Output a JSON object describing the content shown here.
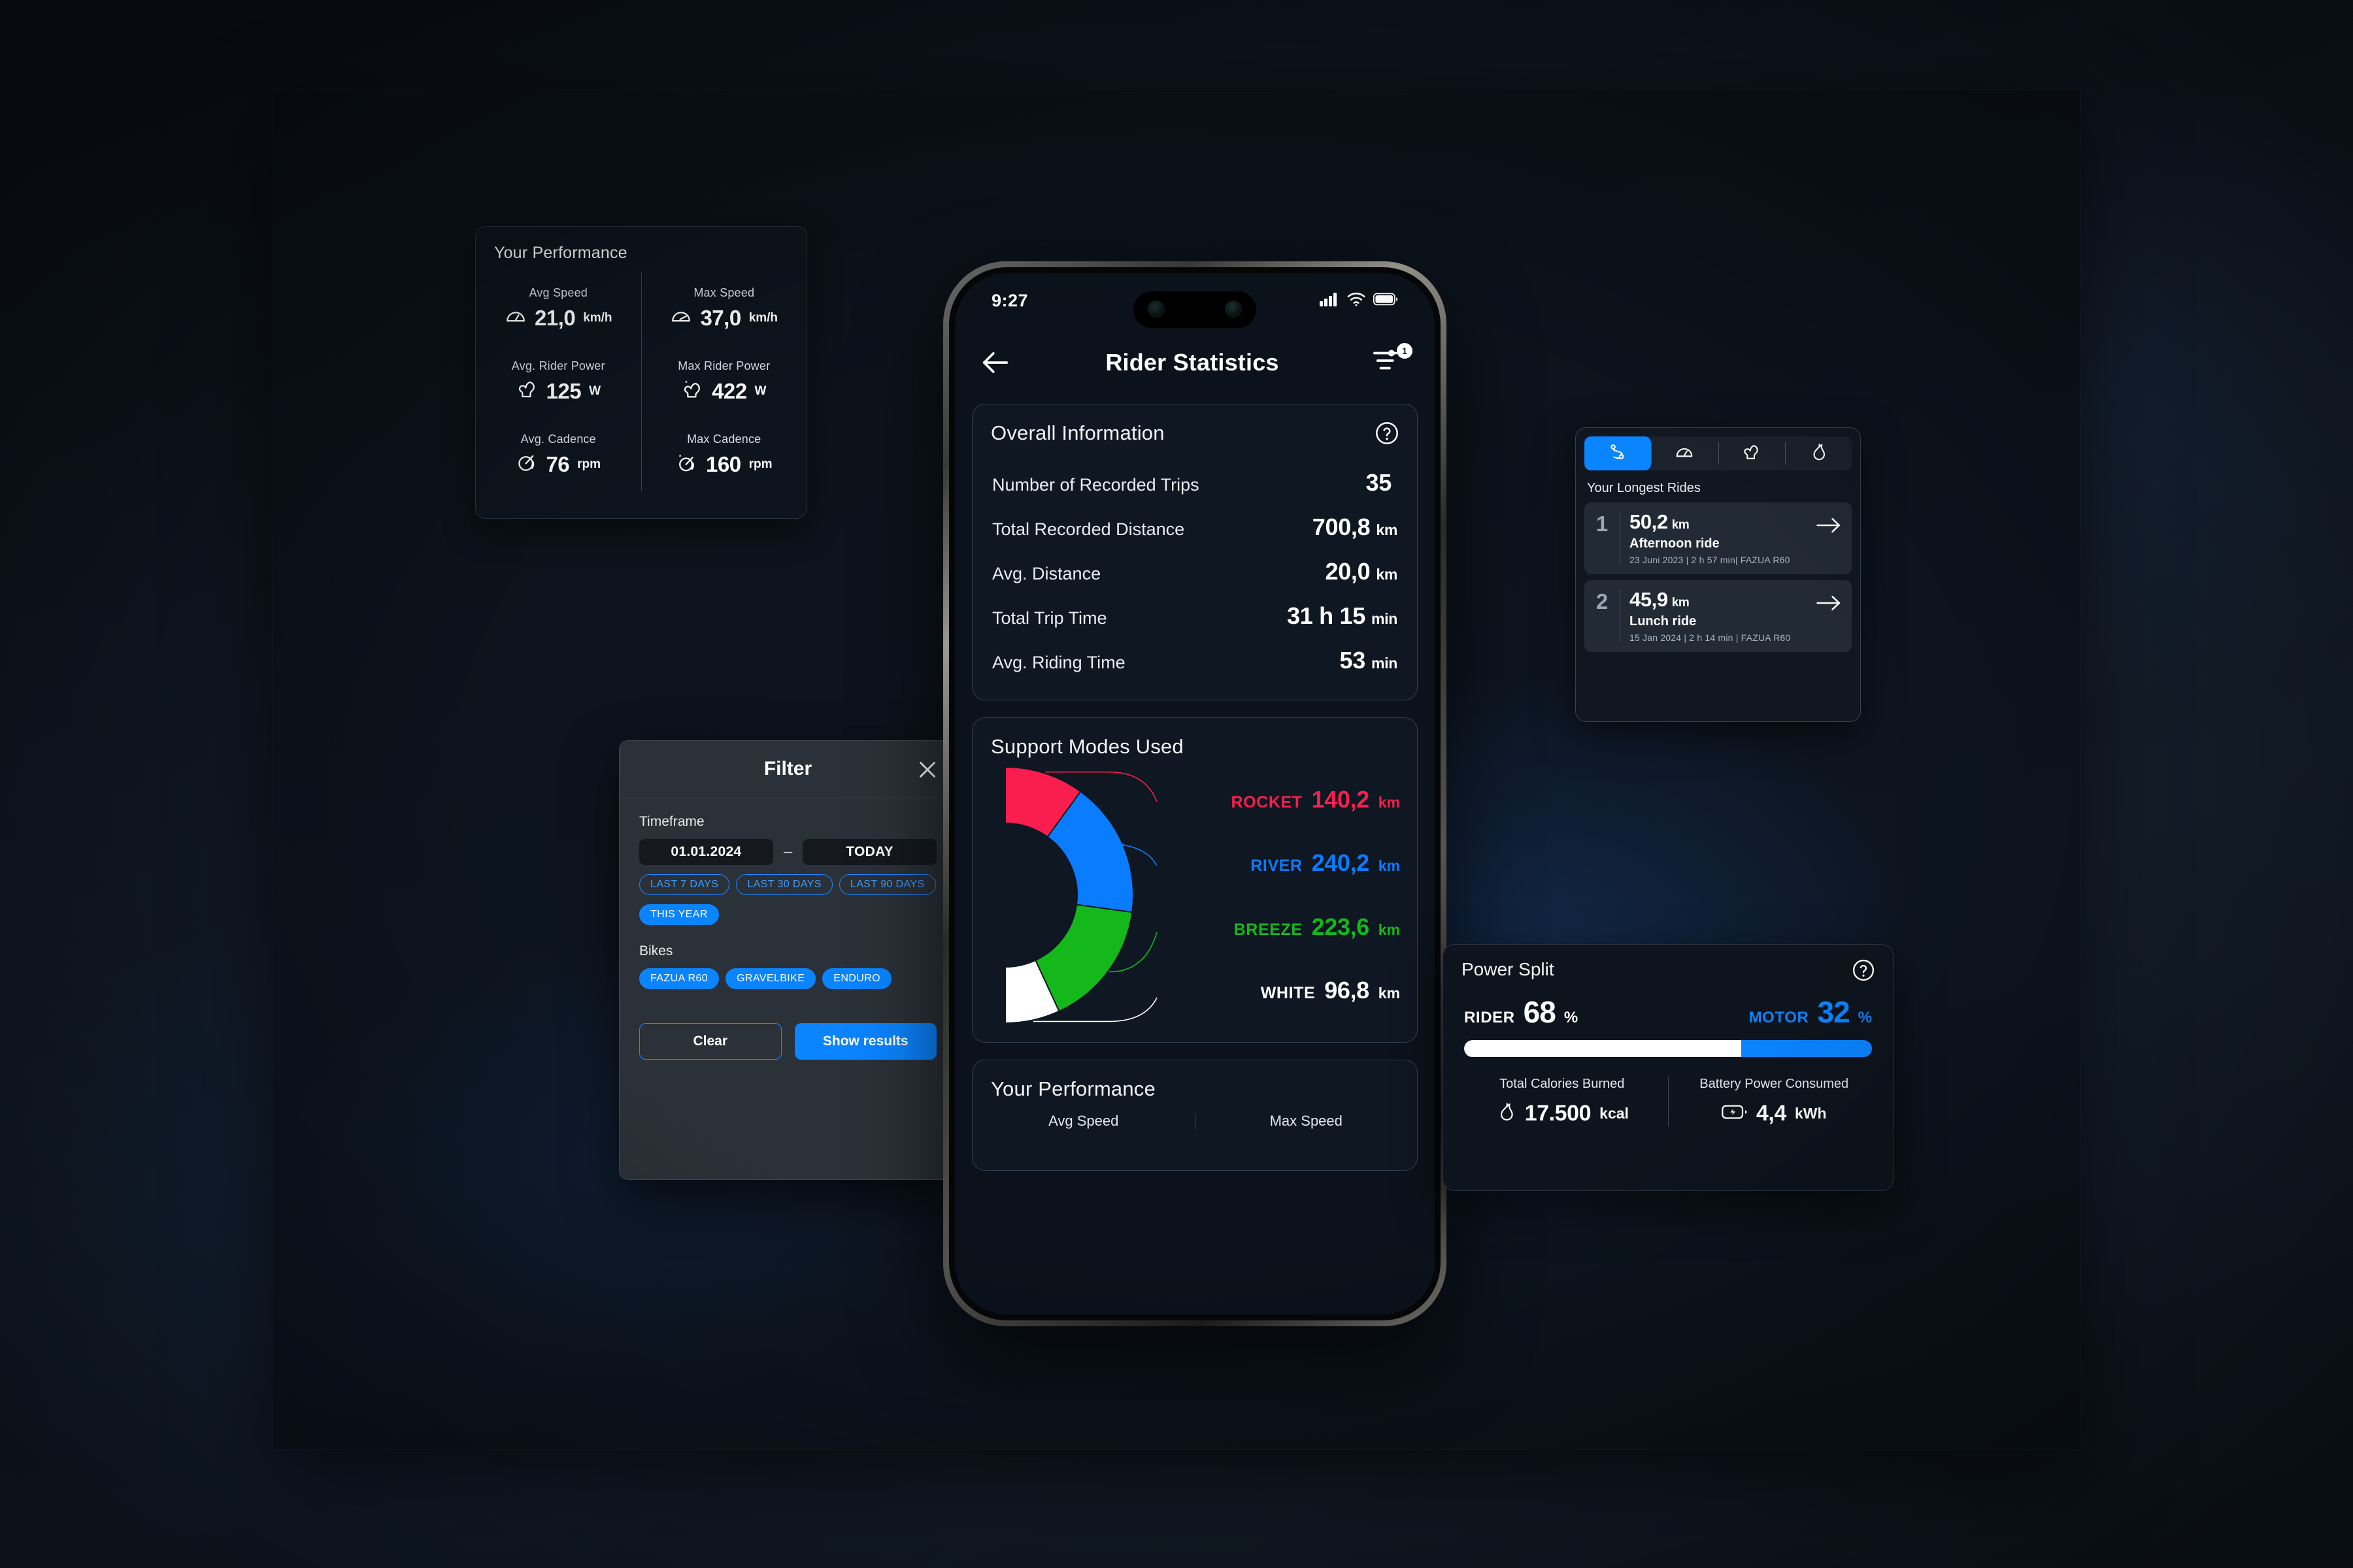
{
  "perf_card": {
    "title": "Your Performance",
    "metrics": [
      {
        "label": "Avg Speed",
        "value": "21,0",
        "unit": "km/h",
        "icon": "speedometer-icon"
      },
      {
        "label": "Max Speed",
        "value": "37,0",
        "unit": "km/h",
        "icon": "max-speedometer-icon"
      },
      {
        "label": "Avg. Rider Power",
        "value": "125",
        "unit": "W",
        "icon": "muscle-icon"
      },
      {
        "label": "Max Rider Power",
        "value": "422",
        "unit": "W",
        "icon": "max-muscle-icon"
      },
      {
        "label": "Avg. Cadence",
        "value": "76",
        "unit": "rpm",
        "icon": "cadence-icon"
      },
      {
        "label": "Max Cadence",
        "value": "160",
        "unit": "rpm",
        "icon": "max-cadence-icon"
      }
    ]
  },
  "filter": {
    "title": "Filter",
    "close_icon": "close-icon",
    "timeframe_label": "Timeframe",
    "date_from": "01.01.2024",
    "date_separator": "–",
    "date_to": "TODAY",
    "quick_ranges": [
      {
        "label": "LAST 7 DAYS",
        "selected": false
      },
      {
        "label": "LAST 30 DAYS",
        "selected": false
      },
      {
        "label": "LAST 90 DAYS",
        "selected": false
      },
      {
        "label": "THIS YEAR",
        "selected": true
      }
    ],
    "bikes_label": "Bikes",
    "bikes": [
      {
        "label": "FAZUA R60",
        "selected": true
      },
      {
        "label": "GRAVELBIKE",
        "selected": true
      },
      {
        "label": "ENDURO",
        "selected": true
      }
    ],
    "clear_label": "Clear",
    "show_results_label": "Show results"
  },
  "phone": {
    "status": {
      "time": "9:27",
      "cellular_icon": "cellular-bars-icon",
      "wifi_icon": "wifi-icon",
      "battery_icon": "battery-icon"
    },
    "nav": {
      "back_icon": "arrow-left-icon",
      "title": "Rider Statistics",
      "filter_icon": "filter-sort-icon",
      "filter_badge": "1"
    },
    "overall": {
      "title": "Overall Information",
      "help_icon": "help-circle-icon",
      "rows": [
        {
          "key": "Number of Recorded Trips",
          "value": "35",
          "unit": ""
        },
        {
          "key": "Total Recorded Distance",
          "value": "700,8",
          "unit": "km"
        },
        {
          "key": "Avg. Distance",
          "value": "20,0",
          "unit": "km"
        },
        {
          "key": "Total Trip Time",
          "value": "31 h 15",
          "unit": "min"
        },
        {
          "key": "Avg. Riding Time",
          "value": "53",
          "unit": "min"
        }
      ]
    },
    "modes": {
      "title": "Support Modes Used"
    },
    "performance": {
      "title": "Your Performance",
      "col_left": "Avg Speed",
      "col_right": "Max Speed"
    }
  },
  "rides": {
    "tabs": [
      {
        "icon": "route-icon",
        "active": true
      },
      {
        "icon": "speedometer-icon",
        "active": false
      },
      {
        "icon": "muscle-icon",
        "active": false
      },
      {
        "icon": "flame-icon",
        "active": false
      }
    ],
    "title": "Your Longest Rides",
    "items": [
      {
        "rank": "1",
        "distance": "50,2",
        "unit": "km",
        "name": "Afternoon ride",
        "meta": "23 Juni 2023 | 2 h 57 min| FAZUA R60",
        "arrow_icon": "arrow-right-icon"
      },
      {
        "rank": "2",
        "distance": "45,9",
        "unit": "km",
        "name": "Lunch ride",
        "meta": "15 Jan 2024 | 2 h 14 min | FAZUA R60",
        "arrow_icon": "arrow-right-icon"
      }
    ]
  },
  "power": {
    "title": "Power Split",
    "help_icon": "help-circle-icon",
    "rider_label": "RIDER",
    "rider_value": "68",
    "rider_pct": "%",
    "motor_label": "MOTOR",
    "motor_value": "32",
    "motor_pct": "%",
    "rider_color": "#ffffff",
    "motor_color": "#0a84ff",
    "calories_label": "Total Calories Burned",
    "calories_value": "17.500",
    "calories_unit": "kcal",
    "calories_icon": "flame-icon",
    "battery_label": "Battery Power Consumed",
    "battery_value": "4,4",
    "battery_unit": "kWh",
    "battery_icon": "battery-charging-icon"
  },
  "chart_data": {
    "type": "pie",
    "title": "Support Modes Used",
    "categories": [
      "ROCKET",
      "RIVER",
      "BREEZE",
      "WHITE"
    ],
    "values": [
      140.2,
      240.2,
      223.6,
      96.8
    ],
    "value_labels": [
      "140,2",
      "240,2",
      "223,6",
      "96,8"
    ],
    "unit": "km",
    "colors": [
      "#fa1e4e",
      "#0a7cff",
      "#15b81b",
      "#ffffff"
    ],
    "total": 700.8,
    "shape": "half-donut",
    "start_angle_deg": -90,
    "sweep_deg": 180,
    "legend": "right"
  }
}
